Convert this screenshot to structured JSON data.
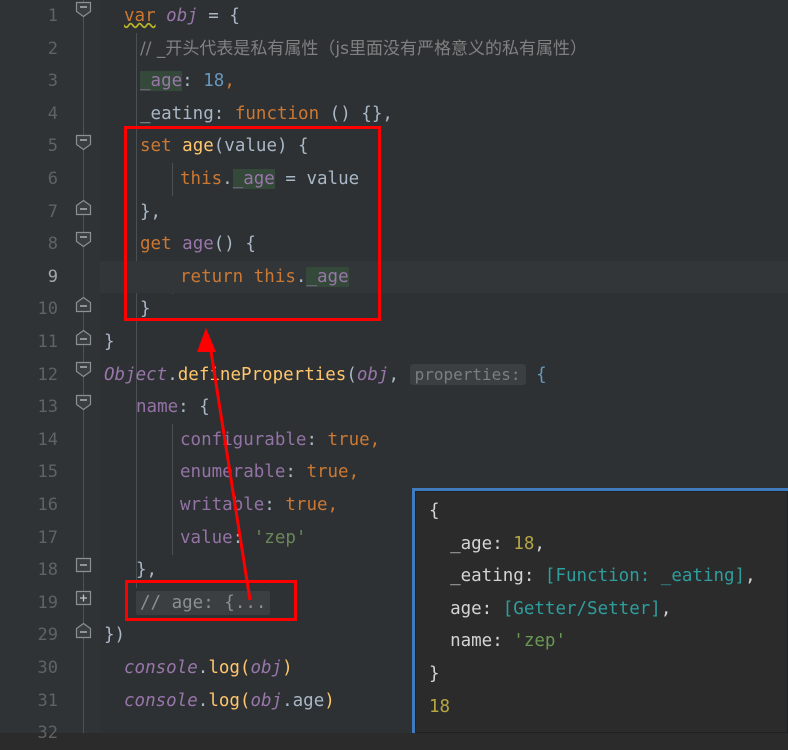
{
  "editor": {
    "theme_background": "#2e3133",
    "gutter_background": "#303335",
    "current_line": 9,
    "line_numbers": [
      "1",
      "2",
      "3",
      "4",
      "5",
      "6",
      "7",
      "8",
      "9",
      "10",
      "11",
      "12",
      "13",
      "14",
      "15",
      "16",
      "17",
      "18",
      "19",
      "29",
      "30",
      "31",
      "32"
    ]
  },
  "code": {
    "line1": {
      "kw": "var",
      "obj": "obj",
      "eq": " = ",
      "brace": "{"
    },
    "line2": {
      "comment": "// _开头代表是私有属性（js里面没有严格意义的私有属性）"
    },
    "line3": {
      "prop": "_age",
      "colon": ": ",
      "num": "18",
      "comma": ","
    },
    "line4": {
      "prop": "_eating",
      "colon": ": ",
      "kw": "function",
      "rest": " () {},"
    },
    "line5": {
      "kw": "set",
      "name": "age",
      "params": "(value) {"
    },
    "line6": {
      "this": "this",
      "dot": ".",
      "prop": "_age",
      "eq": " = ",
      "value": "value"
    },
    "line7": {
      "text": "},"
    },
    "line8": {
      "kw": "get",
      "name": "age",
      "params": "() {"
    },
    "line9": {
      "kw": "return",
      "this": "this",
      "dot": ".",
      "prop": "_age"
    },
    "line10": {
      "text": "}"
    },
    "line11": {
      "text": "}"
    },
    "line12": {
      "object": "Object",
      "dot": ".",
      "method": "defineProperties",
      "paren": "(",
      "arg": "obj",
      "comma": ", ",
      "hint": "properties:",
      "brace": "{"
    },
    "line13": {
      "prop": "name",
      "colon": ": ",
      "brace": "{"
    },
    "line14": {
      "prop": "configurable",
      "colon": ": ",
      "value": "true",
      "comma": ","
    },
    "line15": {
      "prop": "enumerable",
      "colon": ": ",
      "value": "true",
      "comma": ","
    },
    "line16": {
      "prop": "writable",
      "colon": ": ",
      "value": "true",
      "comma": ","
    },
    "line17": {
      "prop": "value",
      "colon": ": ",
      "str": "'zep'"
    },
    "line18": {
      "text": "},"
    },
    "line19": {
      "folded": "// age: {..."
    },
    "line29": {
      "text": "})"
    },
    "line30": {
      "console": "console",
      "dot": ".",
      "log": "log",
      "paren1": "(",
      "arg": "obj",
      "paren2": ")"
    },
    "line31": {
      "console": "console",
      "dot": ".",
      "log": "log",
      "paren1": "(",
      "arg": "obj",
      "dot2": ".",
      "prop": "age",
      "paren2": ")"
    },
    "line32": {
      "text": ""
    }
  },
  "output": {
    "border_color": "#3f7cbf",
    "lines": [
      {
        "text": "{",
        "kind": "brace"
      },
      {
        "key": "  _age: ",
        "value": "18",
        "value_kind": "number",
        "tail": ","
      },
      {
        "key": "  _eating: ",
        "value": "[Function: _eating]",
        "value_kind": "special",
        "tail": ","
      },
      {
        "key": "  age: ",
        "value": "[Getter/Setter]",
        "value_kind": "special",
        "tail": ","
      },
      {
        "key": "  name: ",
        "value": "'zep'",
        "value_kind": "string",
        "tail": ""
      },
      {
        "text": "}",
        "kind": "brace"
      },
      {
        "text": "18",
        "kind": "number"
      }
    ]
  },
  "annotations": {
    "accent_color": "#fe0000",
    "box_accessors_label": "accessors-highlight-box",
    "box_folded_label": "folded-line-highlight-box",
    "arrow_label": "pointer-arrow"
  }
}
